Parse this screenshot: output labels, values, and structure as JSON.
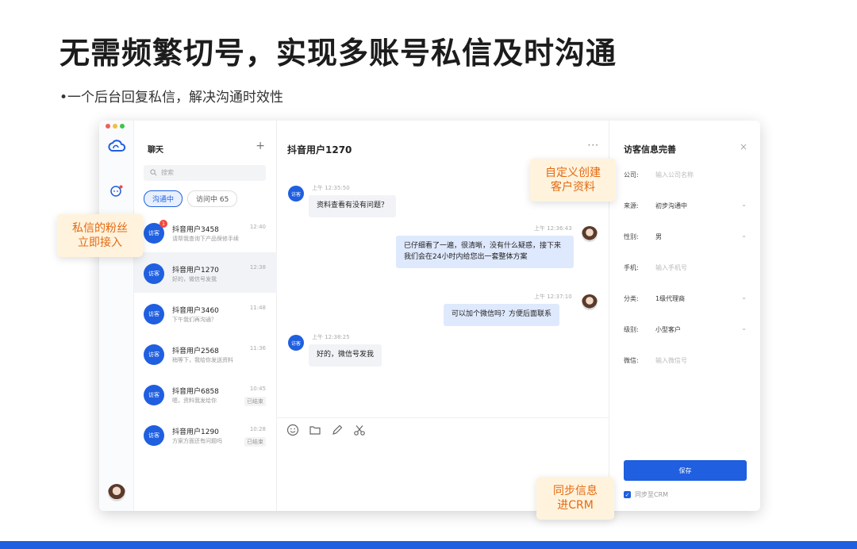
{
  "headline": "无需频繁切号，实现多账号私信及时沟通",
  "subline": "•一个后台回复私信，解决沟通时效性",
  "list": {
    "title": "聊天",
    "plus": "+",
    "search_placeholder": "搜索",
    "tabs": [
      "沟通中",
      "访问中 65"
    ],
    "conversations": [
      {
        "avatar": "访客",
        "badge": "1",
        "name": "抖音用户3458",
        "preview": "请帮我查询下产品保修手续",
        "time": "12:40",
        "status": ""
      },
      {
        "avatar": "访客",
        "badge": "",
        "name": "抖音用户1270",
        "preview": "好的，微信号发我",
        "time": "12:38",
        "status": ""
      },
      {
        "avatar": "访客",
        "badge": "",
        "name": "抖音用户3460",
        "preview": "下午我们再沟通？",
        "time": "11:48",
        "status": ""
      },
      {
        "avatar": "访客",
        "badge": "",
        "name": "抖音用户2568",
        "preview": "稍等下，我给你发送资料",
        "time": "11:36",
        "status": ""
      },
      {
        "avatar": "访客",
        "badge": "",
        "name": "抖音用户6858",
        "preview": "嗯，资料我发给你",
        "time": "10:45",
        "status": "已结束"
      },
      {
        "avatar": "访客",
        "badge": "",
        "name": "抖音用户1290",
        "preview": "方案方面还有问题吗",
        "time": "10:28",
        "status": "已结束"
      }
    ]
  },
  "chat": {
    "title": "抖音用户1270",
    "more": "···",
    "messages": [
      {
        "side": "in",
        "avatar": "访客",
        "time": "上午 12:35:50",
        "text": "资料查看有没有问题？"
      },
      {
        "side": "out",
        "avatar": "",
        "time": "上午 12:36:43",
        "text": "已仔细看了一遍，很清晰，没有什么疑惑，接下来我们会在24小时内给您出一套整体方案"
      },
      {
        "side": "out",
        "avatar": "",
        "time": "上午 12:37:10",
        "text": "可以加个微信吗？方便后面联系"
      },
      {
        "side": "in",
        "avatar": "访客",
        "time": "上午 12:38:25",
        "text": "好的，微信号发我"
      }
    ],
    "tools": [
      "emoji-icon",
      "folder-icon",
      "pen-icon",
      "scissors-icon"
    ]
  },
  "info": {
    "title": "访客信息完善",
    "close": "×",
    "fields": [
      {
        "label": "公司:",
        "value": "输入公司名称",
        "placeholder": true,
        "select": false
      },
      {
        "label": "来源:",
        "value": "初步沟通中",
        "placeholder": false,
        "select": true
      },
      {
        "label": "性别:",
        "value": "男",
        "placeholder": false,
        "select": true
      },
      {
        "label": "手机:",
        "value": "输入手机号",
        "placeholder": true,
        "select": false
      },
      {
        "label": "分类:",
        "value": "1级代理商",
        "placeholder": false,
        "select": true
      },
      {
        "label": "级别:",
        "value": "小型客户",
        "placeholder": false,
        "select": true
      },
      {
        "label": "微信:",
        "value": "输入微信号",
        "placeholder": true,
        "select": false
      }
    ],
    "save": "保存",
    "sync": "同步至CRM",
    "sync_checked": true
  },
  "callouts": {
    "fans": "私信的粉丝\n立即接入",
    "custom": "自定义创建\n客户资料",
    "crm": "同步信息\n进CRM"
  },
  "colors": {
    "accent": "#1f5fe0",
    "callout_text": "#e46a12",
    "callout_bg": "#fff3dd"
  }
}
